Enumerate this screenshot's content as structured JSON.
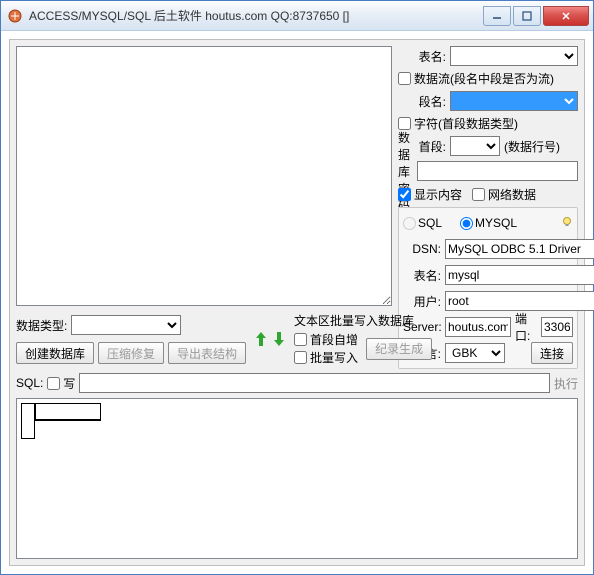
{
  "window": {
    "title": "ACCESS/MYSQL/SQL 后土软件 houtus.com QQ:8737650 []"
  },
  "right": {
    "tableLabel": "表名:",
    "dataflowChk": "数据流(段名中段是否为流)",
    "segLabel": "段名:",
    "charChk": "字符(首段数据类型)",
    "firstSegLabel": "首段:",
    "rownoLabel": "(数据行号)",
    "dbpwdLabel": "数据库密码",
    "showContentChk": "显示内容",
    "netDataChk": "网络数据"
  },
  "db": {
    "sqlRadio": "SQL",
    "mysqlRadio": "MYSQL",
    "dsnLabel": "DSN:",
    "dsnValue": "MySQL ODBC 5.1 Driver",
    "tableLabel": "表名:",
    "tableValue": "mysql",
    "userLabel": "用户:",
    "userValue": "root",
    "serverLabel": "Server:",
    "serverValue": "houtus.com",
    "portLabel": "端口:",
    "portValue": "3306",
    "langLabel": "语言:",
    "langValue": "GBK",
    "connectBtn": "连接"
  },
  "mid": {
    "dataTypeLabel": "数据类型:",
    "createDbBtn": "创建数据库",
    "compressBtn": "压缩修复",
    "exportBtn": "导出表结构",
    "batchWriteDbLabel": "文本区批量写入数据库",
    "firstAutoChk": "首段自增",
    "batchWriteChk": "批量写入",
    "genRecBtn": "纪录生成"
  },
  "sql": {
    "label": "SQL:",
    "writeChk": "写",
    "execLabel": "执行"
  }
}
